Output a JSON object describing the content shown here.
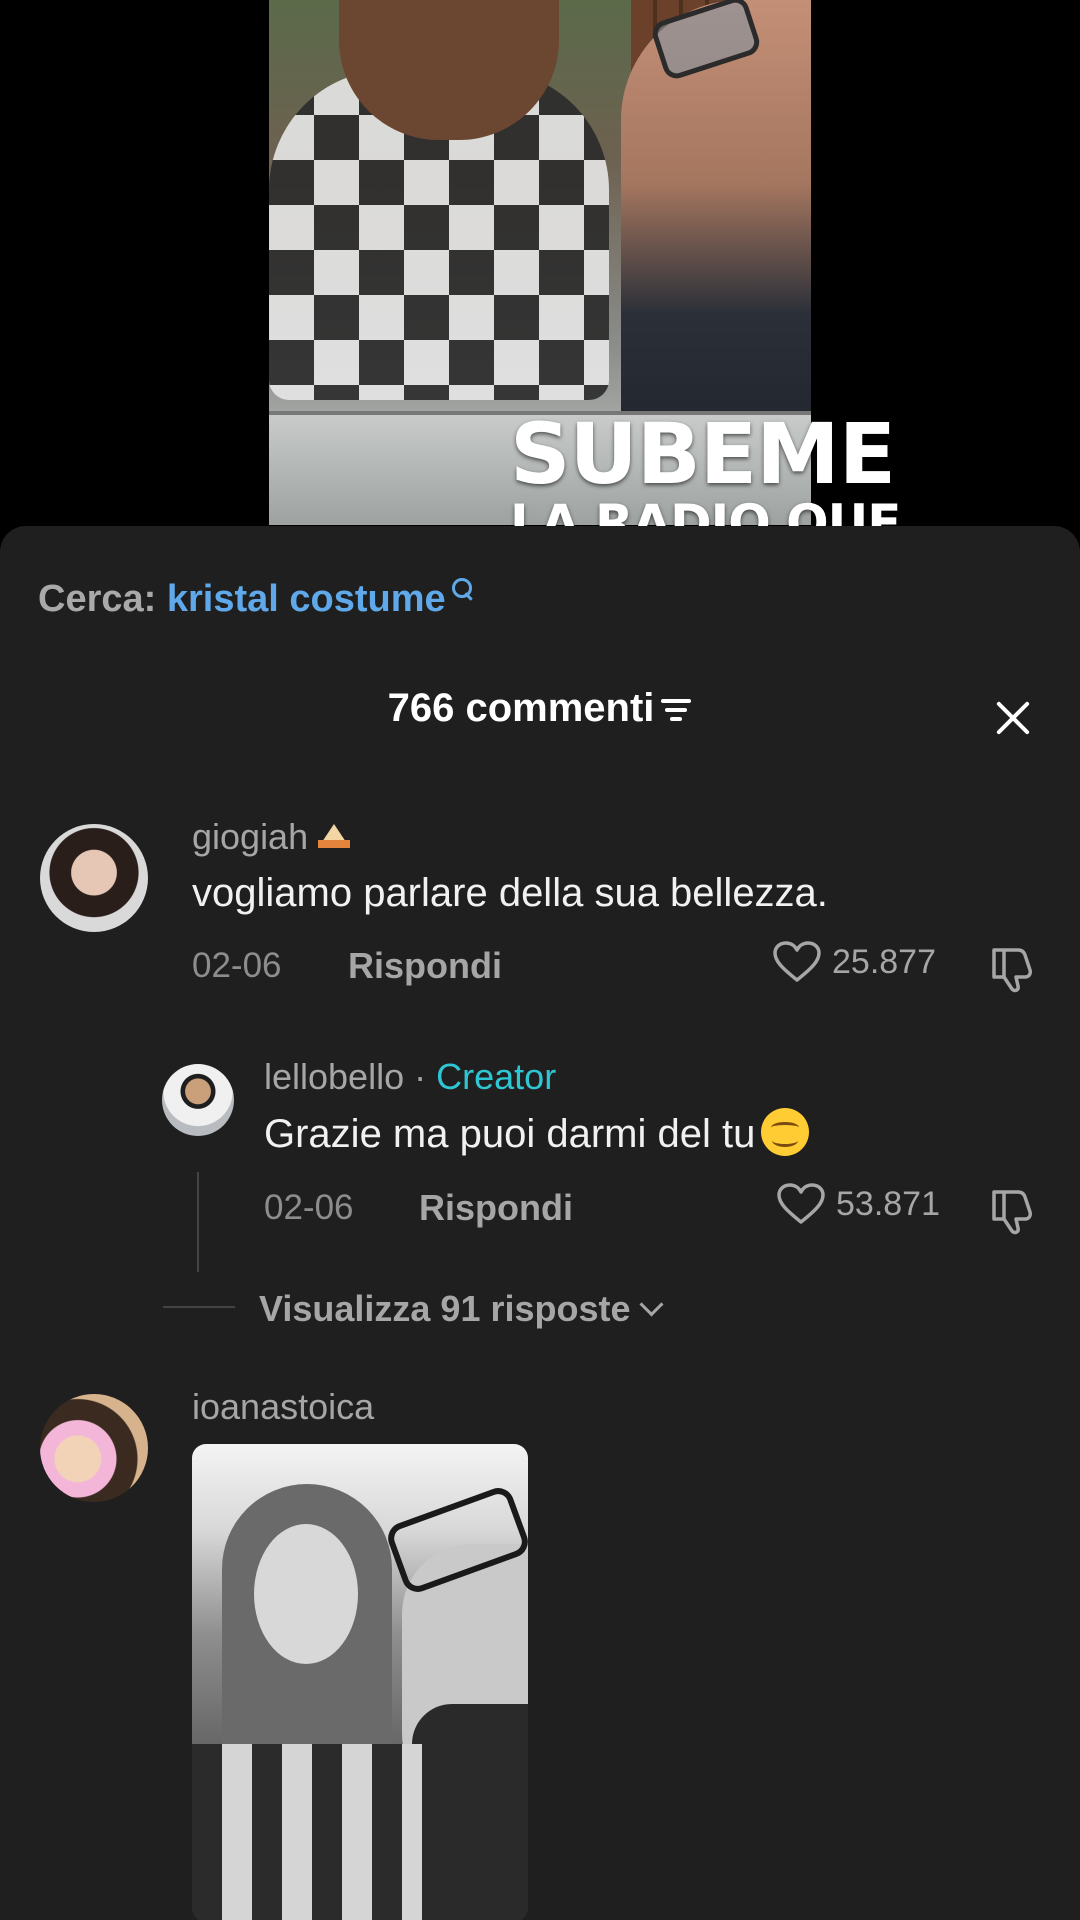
{
  "video": {
    "caption_line1": "SUBEME",
    "caption_line2": "LA RADIO QUE"
  },
  "search_suggestion": {
    "prefix": "Cerca:",
    "term": "kristal costume",
    "icon": "search-icon"
  },
  "header": {
    "title": "766 commenti",
    "sort_icon": "sort-icon",
    "close_icon": "close-icon"
  },
  "comments": [
    {
      "username": "giogiah",
      "username_emoji": "cake-emoji",
      "text": "vogliamo parlare della sua bellezza.",
      "date": "02-06",
      "reply_label": "Rispondi",
      "likes": "25.877"
    },
    {
      "username": "lellobello",
      "separator": "·",
      "badge": "Creator",
      "text": "Grazie ma puoi darmi del tu",
      "text_emoji": "smiling-face-emoji",
      "date": "02-06",
      "reply_label": "Rispondi",
      "likes": "53.871"
    },
    {
      "username": "ioanastoica",
      "attachment": "photo"
    }
  ],
  "view_replies": "Visualizza 91 risposte",
  "colors": {
    "sheet_bg": "#1f1f1f",
    "link_blue": "#5fa8ea",
    "creator_teal": "#2fc6d4",
    "muted_text": "#a6a6a6"
  }
}
